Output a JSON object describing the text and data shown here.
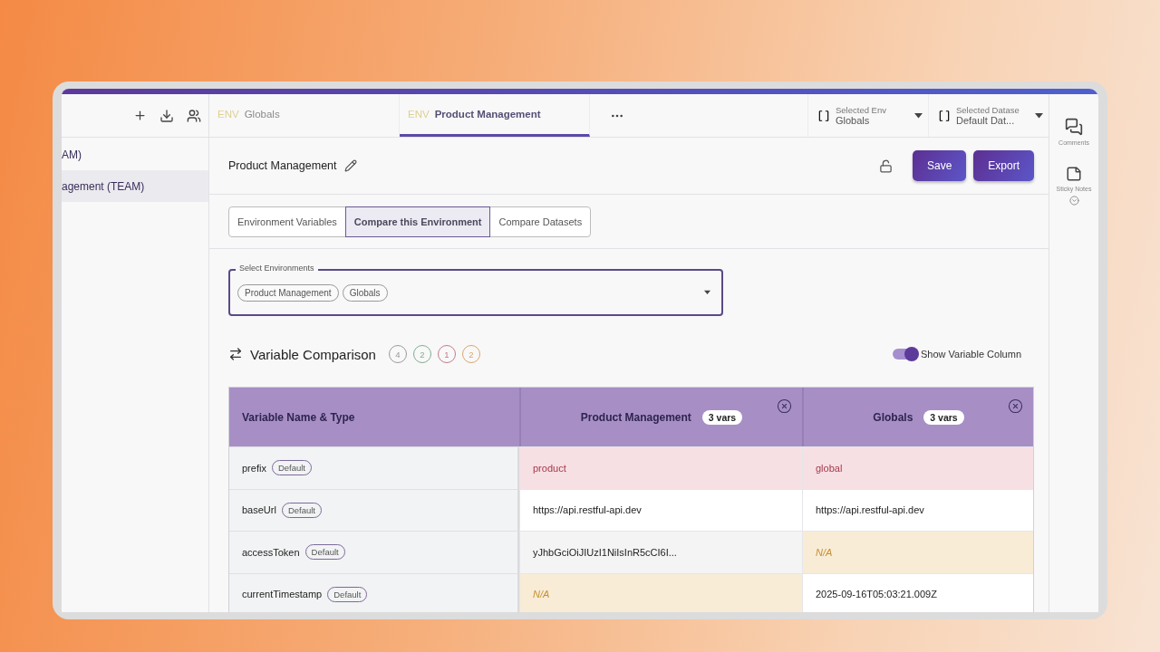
{
  "sidebar": {
    "items": [
      {
        "label": "AM)",
        "selected": false
      },
      {
        "label": "agement (TEAM)",
        "selected": true
      }
    ]
  },
  "tabs": [
    {
      "prefix": "ENV",
      "label": "Globals",
      "selected": false
    },
    {
      "prefix": "ENV",
      "label": "Product Management",
      "selected": true
    }
  ],
  "selectors": [
    {
      "label": "Selected Env",
      "value": "Globals"
    },
    {
      "label": "Selected Datase",
      "value": "Default Dat..."
    }
  ],
  "title": "Product Management",
  "buttons": [
    "Save",
    "Export"
  ],
  "view_tabs": [
    {
      "label": "Environment Variables",
      "selected": false
    },
    {
      "label": "Compare this Environment",
      "selected": true
    },
    {
      "label": "Compare Datasets",
      "selected": false
    }
  ],
  "select_environments": {
    "label": "Select Environments",
    "chips": [
      "Product Management",
      "Globals"
    ]
  },
  "comparison": {
    "title": "Variable Comparison",
    "counts": [
      {
        "value": "4",
        "color": "#9a9a9a"
      },
      {
        "value": "2",
        "color": "#7fae8e"
      },
      {
        "value": "1",
        "color": "#c47a86"
      },
      {
        "value": "2",
        "color": "#d9a66a"
      }
    ],
    "toggle": {
      "label": "Show Variable Column",
      "on": true
    }
  },
  "table": {
    "columns": [
      {
        "label": "Variable Name & Type"
      },
      {
        "label": "Product Management",
        "count": "3 vars"
      },
      {
        "label": "Globals",
        "count": "3 vars"
      }
    ],
    "rows": [
      {
        "name": "prefix",
        "type": "Default",
        "cells": [
          {
            "value": "product",
            "kind": "diff"
          },
          {
            "value": "global",
            "kind": "diff"
          }
        ]
      },
      {
        "name": "baseUrl",
        "type": "Default",
        "cells": [
          {
            "value": "https://api.restful-api.dev",
            "kind": "same"
          },
          {
            "value": "https://api.restful-api.dev",
            "kind": "same"
          }
        ]
      },
      {
        "name": "accessToken",
        "type": "Default",
        "cells": [
          {
            "value": "yJhbGciOiJIUzI1NiIsInR5cCI6I...",
            "kind": "same"
          },
          {
            "value": "N/A",
            "kind": "missing"
          }
        ]
      },
      {
        "name": "currentTimestamp",
        "type": "Default",
        "cells": [
          {
            "value": "N/A",
            "kind": "missing"
          },
          {
            "value": "2025-09-16T05:03:21.009Z",
            "kind": "same"
          }
        ]
      }
    ]
  },
  "rail": [
    {
      "label": "Comments",
      "kind": "comments"
    },
    {
      "label": "Sticky Notes",
      "kind": "notes"
    }
  ]
}
